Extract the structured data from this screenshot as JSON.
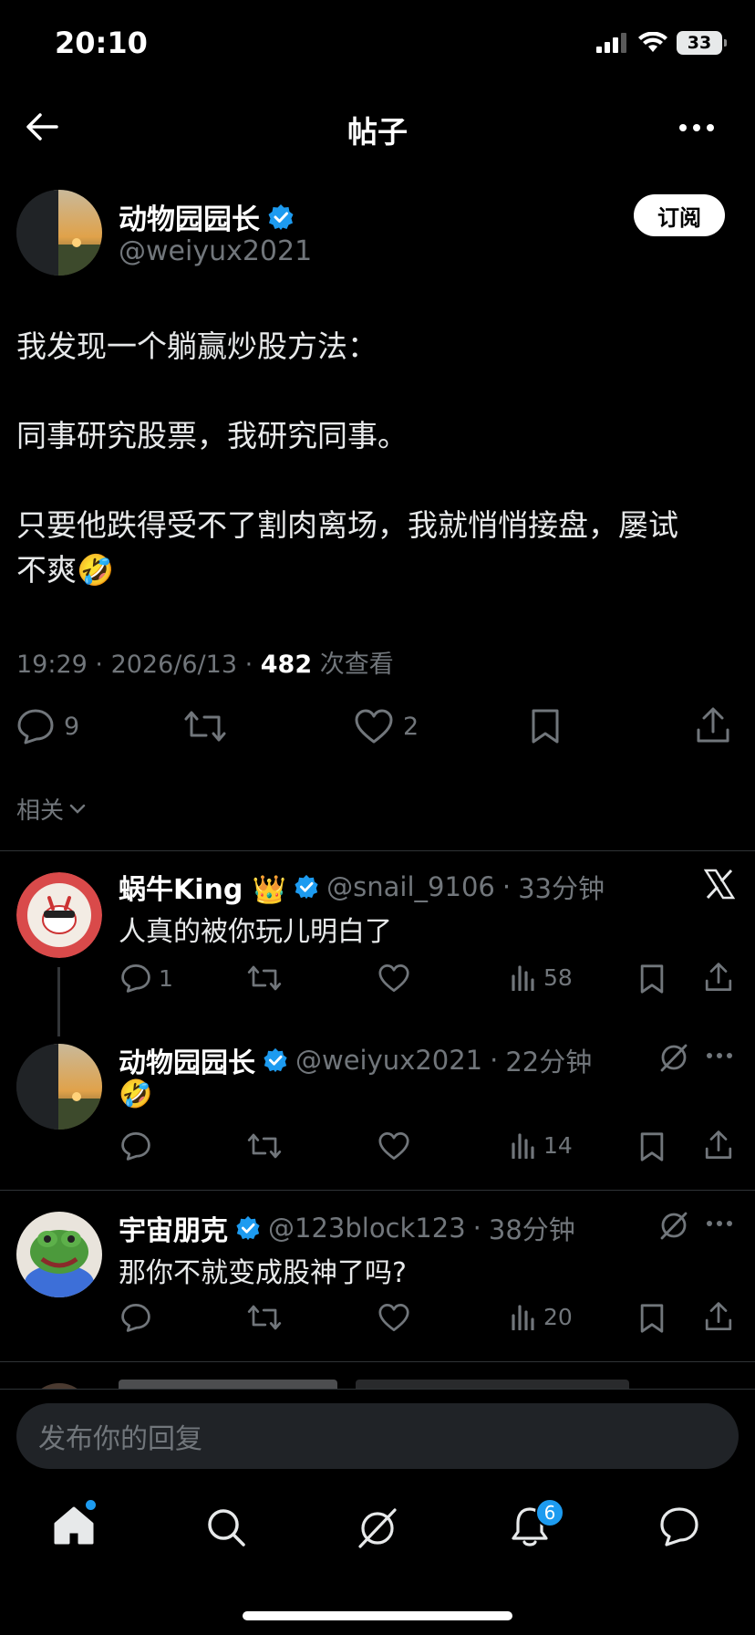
{
  "status_bar": {
    "time": "20:10",
    "battery": "33"
  },
  "header": {
    "title": "帖子"
  },
  "post": {
    "author_name": "动物园园长",
    "author_handle": "@weiyux2021",
    "subscribe_label": "订阅",
    "lines": [
      "我发现一个躺赢炒股方法：",
      "同事研究股票，我研究同事。",
      "只要他跌得受不了割肉离场，我就悄悄接盘，屡试",
      "不爽🤣"
    ],
    "time": "19:29",
    "date": "2026/6/13",
    "views": "482",
    "views_label": "次查看",
    "replies": "9",
    "likes": "2"
  },
  "related_label": "相关",
  "replies": [
    {
      "name": "蜗牛King 👑",
      "handle": "@snail_9106",
      "time": "33分钟",
      "text": "人真的被你玩儿明白了",
      "reply_count": "1",
      "views": "58"
    },
    {
      "name": "动物园园长",
      "handle": "@weiyux2021",
      "time": "22分钟",
      "text": "🤣",
      "views": "14"
    },
    {
      "name": "宇宙朋克",
      "handle": "@123block123",
      "time": "38分钟",
      "text": "那你不就变成股神了吗?",
      "views": "20"
    }
  ],
  "reply_placeholder": "发布你的回复",
  "nav": {
    "notifications_badge": "6"
  },
  "colors": {
    "accent": "#1d9bf0",
    "background": "#000000",
    "muted": "#71767b"
  }
}
